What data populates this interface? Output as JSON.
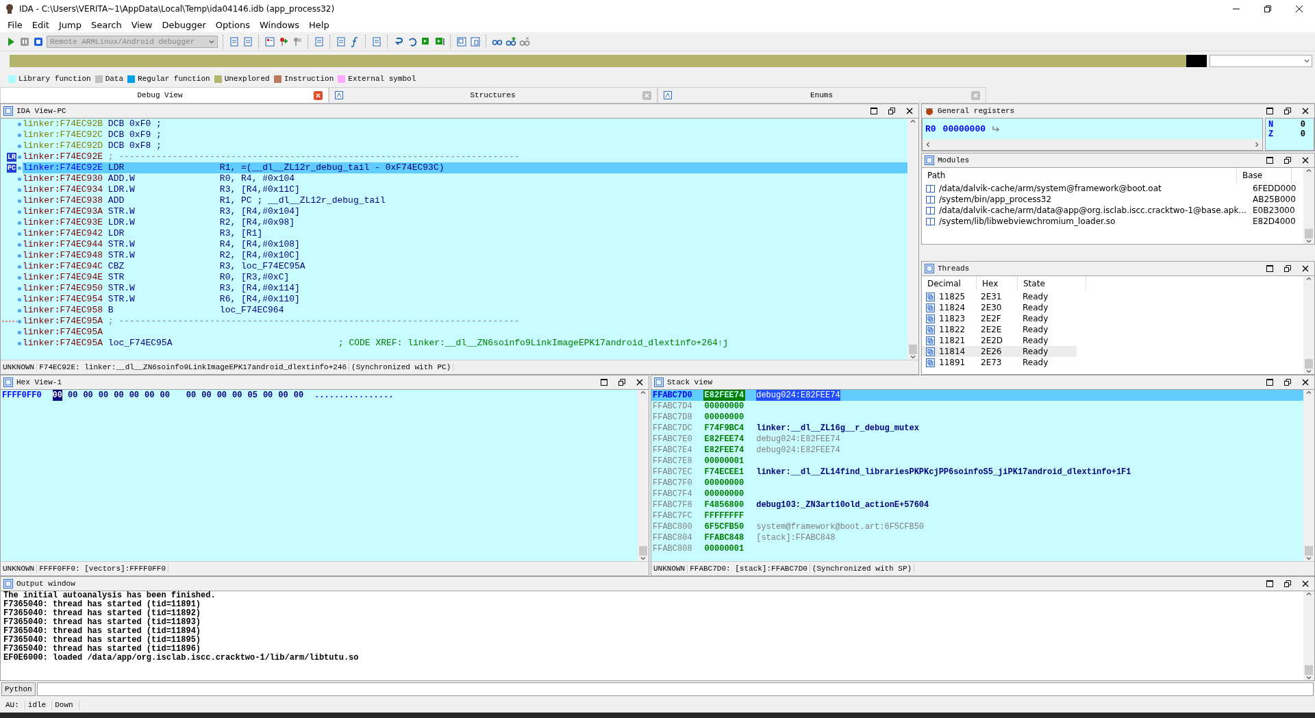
{
  "window": {
    "title": "IDA - C:\\Users\\VERITA~1\\AppData\\Local\\Temp\\ida04146.idb (app_process32)"
  },
  "menu": [
    "File",
    "Edit",
    "Jump",
    "Search",
    "View",
    "Debugger",
    "Options",
    "Windows",
    "Help"
  ],
  "toolbar": {
    "debugger_select": {
      "value": "Remote ARMLinux/Android debugger",
      "disabled": true
    }
  },
  "legend": [
    {
      "label": "Library function",
      "color": "#a8fcff"
    },
    {
      "label": "Data",
      "color": "#c0c0c0"
    },
    {
      "label": "Regular function",
      "color": "#00a0e8"
    },
    {
      "label": "Unexplored",
      "color": "#b4b46c"
    },
    {
      "label": "Instruction",
      "color": "#b87c5c"
    },
    {
      "label": "External symbol",
      "color": "#ffa8ff"
    }
  ],
  "tabs": [
    {
      "label": "Debug View",
      "selected": true
    },
    {
      "label": "Structures",
      "selected": false
    },
    {
      "label": "Enums",
      "selected": false
    }
  ],
  "ida_view": {
    "title": "IDA View-PC",
    "lines": [
      {
        "kind": "data",
        "addr": "linker:F74EC92B",
        "mnemonic": "DCB",
        "operands": "0xF0 ;",
        "selected": false
      },
      {
        "kind": "data",
        "addr": "linker:F74EC92C",
        "mnemonic": "DCB",
        "operands": "0xF9 ;",
        "selected": false
      },
      {
        "kind": "data",
        "addr": "linker:F74EC92D",
        "mnemonic": "DCB",
        "operands": "0xF8 ;",
        "selected": false
      },
      {
        "kind": "separator",
        "addr": "linker:F74EC92E",
        "comment": "; ---------------------------------------------------------------------------",
        "marker": "LR",
        "selected": false
      },
      {
        "kind": "code",
        "addr": "linker:F74EC92E",
        "mnemonic": "LDR",
        "operands": "R1, =(__dl__ZL12r_debug_tail - 0xF74EC93C)",
        "marker": "PC",
        "selected": true
      },
      {
        "kind": "code",
        "addr": "linker:F74EC930",
        "mnemonic": "ADD.W",
        "operands": "R0, R4, #0x104",
        "selected": false
      },
      {
        "kind": "code",
        "addr": "linker:F74EC934",
        "mnemonic": "LDR.W",
        "operands": "R3, [R4,#0x11C]",
        "selected": false
      },
      {
        "kind": "code",
        "addr": "linker:F74EC938",
        "mnemonic": "ADD",
        "operands": "R1, PC ; __dl__ZL12r_debug_tail",
        "selected": false
      },
      {
        "kind": "code",
        "addr": "linker:F74EC93A",
        "mnemonic": "STR.W",
        "operands": "R3, [R4,#0x104]",
        "selected": false
      },
      {
        "kind": "code",
        "addr": "linker:F74EC93E",
        "mnemonic": "LDR.W",
        "operands": "R2, [R4,#0x98]",
        "selected": false
      },
      {
        "kind": "code",
        "addr": "linker:F74EC942",
        "mnemonic": "LDR",
        "operands": "R3, [R1]",
        "selected": false
      },
      {
        "kind": "code",
        "addr": "linker:F74EC944",
        "mnemonic": "STR.W",
        "operands": "R4, [R4,#0x108]",
        "selected": false
      },
      {
        "kind": "code",
        "addr": "linker:F74EC948",
        "mnemonic": "STR.W",
        "operands": "R2, [R4,#0x10C]",
        "selected": false
      },
      {
        "kind": "code",
        "addr": "linker:F74EC94C",
        "mnemonic": "CBZ",
        "operands": "R3, loc_F74EC95A",
        "selected": false
      },
      {
        "kind": "code",
        "addr": "linker:F74EC94E",
        "mnemonic": "STR",
        "operands": "R0, [R3,#0xC]",
        "selected": false
      },
      {
        "kind": "code",
        "addr": "linker:F74EC950",
        "mnemonic": "STR.W",
        "operands": "R3, [R4,#0x114]",
        "selected": false
      },
      {
        "kind": "code",
        "addr": "linker:F74EC954",
        "mnemonic": "STR.W",
        "operands": "R6, [R4,#0x110]",
        "selected": false
      },
      {
        "kind": "code",
        "addr": "linker:F74EC958",
        "mnemonic": "B",
        "operands": "loc_F74EC964",
        "selected": false
      },
      {
        "kind": "separator",
        "addr": "linker:F74EC95A",
        "comment": "; ---------------------------------------------------------------------------",
        "selected": false
      },
      {
        "kind": "blank",
        "addr": "linker:F74EC95A",
        "selected": false
      },
      {
        "kind": "label",
        "addr": "linker:F74EC95A",
        "label": "loc_F74EC95A",
        "comment": "; CODE XREF: linker:__dl__ZN6soinfo9LinkImageEPK17android_dlextinfo+264↑j",
        "selected": false
      }
    ],
    "status": [
      "UNKNOWN",
      "F74EC92E: linker:__dl__ZN6soinfo9LinkImageEPK17android_dlextinfo+246",
      "(Synchronized with PC)"
    ]
  },
  "registers": {
    "title": "General registers",
    "reg": {
      "name": "R0",
      "value": "00000000"
    },
    "flags": [
      {
        "name": "N",
        "value": "0"
      },
      {
        "name": "Z",
        "value": "0"
      }
    ]
  },
  "modules": {
    "title": "Modules",
    "columns": [
      "Path",
      "Base"
    ],
    "rows": [
      {
        "path": "/data/dalvik-cache/arm/system@framework@boot.oat",
        "base": "6FEDD000"
      },
      {
        "path": "/system/bin/app_process32",
        "base": "AB25B000"
      },
      {
        "path": "/data/dalvik-cache/arm/data@app@org.isclab.iscc.cracktwo-1@base.apk...",
        "base": "E0B23000"
      },
      {
        "path": "/system/lib/libwebviewchromium_loader.so",
        "base": "E82D4000"
      }
    ]
  },
  "threads": {
    "title": "Threads",
    "columns": [
      "Decimal",
      "Hex",
      "State"
    ],
    "rows": [
      {
        "decimal": "11825",
        "hex": "2E31",
        "state": "Ready",
        "selected": false
      },
      {
        "decimal": "11824",
        "hex": "2E30",
        "state": "Ready",
        "selected": false
      },
      {
        "decimal": "11823",
        "hex": "2E2F",
        "state": "Ready",
        "selected": false
      },
      {
        "decimal": "11822",
        "hex": "2E2E",
        "state": "Ready",
        "selected": false
      },
      {
        "decimal": "11821",
        "hex": "2E2D",
        "state": "Ready",
        "selected": false
      },
      {
        "decimal": "11814",
        "hex": "2E26",
        "state": "Ready",
        "selected": true
      },
      {
        "decimal": "11891",
        "hex": "2E73",
        "state": "Ready",
        "selected": false
      }
    ]
  },
  "hex_view": {
    "title": "Hex View-1",
    "lines": [
      {
        "addr": "FFFF0FF0",
        "bytes": [
          {
            "value": "00",
            "selected": true
          },
          {
            "value": "00",
            "selected": false
          },
          {
            "value": "00",
            "selected": false
          },
          {
            "value": "00",
            "selected": false
          },
          {
            "value": "00",
            "selected": false
          },
          {
            "value": "00",
            "selected": false
          },
          {
            "value": "00",
            "selected": false
          },
          {
            "value": "00",
            "selected": false
          },
          {
            "value": "00",
            "selected": false
          },
          {
            "value": "00",
            "selected": false
          },
          {
            "value": "00",
            "selected": false
          },
          {
            "value": "00",
            "selected": false
          },
          {
            "value": "05",
            "selected": false
          },
          {
            "value": "00",
            "selected": false
          },
          {
            "value": "00",
            "selected": false
          },
          {
            "value": "00",
            "selected": false
          }
        ],
        "ascii": "................"
      }
    ],
    "status": [
      "UNKNOWN",
      "FFFF0FF0: [vectors]:FFFF0FF0"
    ]
  },
  "stack_view": {
    "title": "Stack view",
    "rows": [
      {
        "addr": "FFABC7D0",
        "value": "E82FEE74",
        "ref": "debug024:E82FEE74",
        "kind": "address",
        "selected": true
      },
      {
        "addr": "FFABC7D4",
        "value": "00000000",
        "selected": false
      },
      {
        "addr": "FFABC7D8",
        "value": "00000000",
        "selected": false
      },
      {
        "addr": "FFABC7DC",
        "value": "F74F9BC4",
        "ref": "linker:__dl__ZL16g__r_debug_mutex",
        "kind": "symbol",
        "selected": false
      },
      {
        "addr": "FFABC7E0",
        "value": "E82FEE74",
        "ref": "debug024:E82FEE74",
        "kind": "address",
        "selected": false
      },
      {
        "addr": "FFABC7E4",
        "value": "E82FEE74",
        "ref": "debug024:E82FEE74",
        "kind": "address",
        "selected": false
      },
      {
        "addr": "FFABC7E8",
        "value": "00000001",
        "selected": false
      },
      {
        "addr": "FFABC7EC",
        "value": "F74ECEE1",
        "ref": "linker:__dl__ZL14find_librariesPKPKcjPP6soinfoS5_jiPK17android_dlextinfo+1F1",
        "kind": "symbol",
        "selected": false
      },
      {
        "addr": "FFABC7F0",
        "value": "00000000",
        "selected": false
      },
      {
        "addr": "FFABC7F4",
        "value": "00000000",
        "selected": false
      },
      {
        "addr": "FFABC7F8",
        "value": "F4856800",
        "ref": "debug103:_ZN3art10old_actionE+57604",
        "kind": "symbol",
        "selected": false
      },
      {
        "addr": "FFABC7FC",
        "value": "FFFFFFFF",
        "selected": false
      },
      {
        "addr": "FFABC800",
        "value": "6F5CFB50",
        "ref": "system@framework@boot.art:6F5CFB50",
        "kind": "address",
        "selected": false
      },
      {
        "addr": "FFABC804",
        "value": "FFABC848",
        "ref": "[stack]:FFABC848",
        "kind": "address",
        "selected": false
      },
      {
        "addr": "FFABC808",
        "value": "00000001",
        "selected": false
      }
    ],
    "status": [
      "UNKNOWN",
      "FFABC7D0: [stack]:FFABC7D0",
      "(Synchronized with SP)"
    ]
  },
  "output": {
    "title": "Output window",
    "lines": [
      "The initial autoanalysis has been finished.",
      "F7365040: thread has started (tid=11891)",
      "F7365040: thread has started (tid=11892)",
      "F7365040: thread has started (tid=11893)",
      "F7365040: thread has started (tid=11894)",
      "F7365040: thread has started (tid=11895)",
      "F7365040: thread has started (tid=11896)",
      "EF0E6000: loaded /data/app/org.isclab.iscc.cracktwo-1/lib/arm/libtutu.so"
    ]
  },
  "python": {
    "button": "Python"
  },
  "status_bar": [
    "AU:",
    "idle",
    "Down"
  ]
}
